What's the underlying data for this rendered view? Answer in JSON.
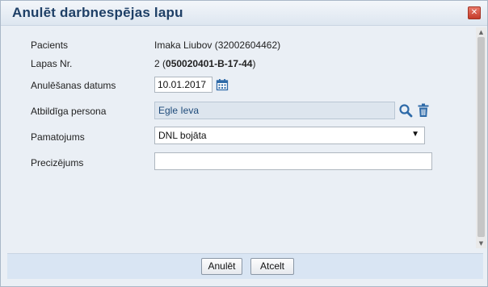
{
  "dialog": {
    "title": "Anulēt darbnespējas lapu",
    "close_glyph": "✕"
  },
  "form": {
    "patient": {
      "label": "Pacients",
      "value": "Imaka Liubov (32002604462)"
    },
    "sheet": {
      "label": "Lapas Nr.",
      "prefix": "2 (",
      "number": "050020401-B-17-44",
      "suffix": ")"
    },
    "date": {
      "label": "Anulēšanas datums",
      "value": "10.01.2017"
    },
    "person": {
      "label": "Atbildīga persona",
      "value": "Egle Ieva"
    },
    "reason": {
      "label": "Pamatojums",
      "value": "DNL bojāta"
    },
    "details": {
      "label": "Precizējums",
      "value": ""
    }
  },
  "footer": {
    "cancel_sheet_label": "Anulēt",
    "cancel_label": "Atcelt"
  },
  "icons": {
    "calendar": "calendar-icon",
    "search": "search-icon",
    "delete": "trash-icon"
  },
  "colors": {
    "title": "#1e3f66",
    "icon_blue": "#2e6aa8",
    "person_text": "#1d4a7a"
  }
}
